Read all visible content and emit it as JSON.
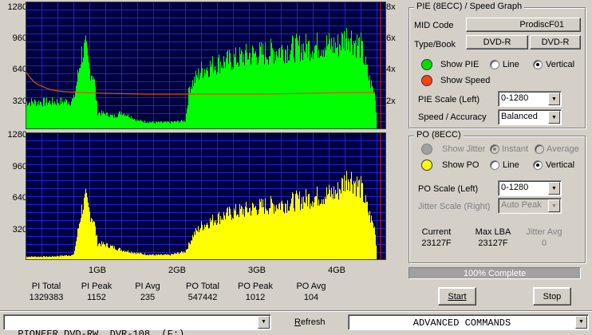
{
  "top_chart": {
    "left_axis": [
      "1280",
      "960",
      "640",
      "320"
    ],
    "right_axis": [
      "8x",
      "6x",
      "4x",
      "2x"
    ],
    "colors": {
      "background": "#000040",
      "grid": "#2a2aff",
      "pie": "#00ff00",
      "speed": "#e05000",
      "marker": "#e02000"
    }
  },
  "bottom_chart": {
    "left_axis": [
      "1280",
      "960",
      "640",
      "320"
    ],
    "colors": {
      "background": "#000040",
      "grid": "#2a2aff",
      "po": "#ffff00"
    }
  },
  "x_axis": [
    "1GB",
    "2GB",
    "3GB",
    "4GB"
  ],
  "chart_data": [
    {
      "type": "area",
      "title": "PIE (8ECC) / Speed Graph",
      "x_axis_labels": [
        "1GB",
        "2GB",
        "3GB",
        "4GB"
      ],
      "x_unit": "GB",
      "ylim_left": [
        0,
        1280
      ],
      "ylim_right": [
        0,
        8
      ],
      "series": [
        {
          "name": "PIE",
          "x": [
            0,
            0.3,
            0.55,
            0.6,
            0.7,
            0.75,
            0.8,
            0.85,
            0.9,
            1.0,
            1.1,
            1.2,
            1.3,
            1.4,
            1.5,
            1.6,
            1.7,
            1.8,
            1.9,
            2.0,
            2.05,
            2.1,
            2.2,
            2.4,
            2.6,
            2.8,
            3.0,
            3.2,
            3.4,
            3.6,
            3.8,
            3.9,
            4.0,
            4.05,
            4.1,
            4.2,
            4.3,
            4.38,
            4.4
          ],
          "values": [
            320,
            320,
            330,
            350,
            900,
            950,
            700,
            640,
            200,
            180,
            150,
            200,
            160,
            100,
            90,
            80,
            80,
            80,
            90,
            100,
            500,
            560,
            700,
            780,
            820,
            880,
            900,
            940,
            960,
            980,
            1000,
            980,
            1080,
            1120,
            1050,
            980,
            600,
            400,
            0
          ]
        },
        {
          "name": "Speed",
          "x": [
            0,
            0.05,
            0.1,
            0.15,
            0.2,
            0.3,
            0.4,
            0.5,
            0.7,
            1.0,
            1.5,
            2.0,
            2.5,
            3.0,
            3.5,
            4.0,
            4.38
          ],
          "values": [
            3.6,
            3.3,
            3.0,
            2.8,
            2.7,
            2.5,
            2.4,
            2.35,
            2.3,
            2.25,
            2.2,
            2.2,
            2.2,
            2.2,
            2.25,
            2.3,
            2.3
          ]
        }
      ]
    },
    {
      "type": "area",
      "title": "PO (8ECC)",
      "x_axis_labels": [
        "1GB",
        "2GB",
        "3GB",
        "4GB"
      ],
      "x_unit": "GB",
      "ylim": [
        0,
        1280
      ],
      "series": [
        {
          "name": "PO",
          "x": [
            0,
            0.3,
            0.6,
            0.7,
            0.75,
            0.8,
            0.85,
            0.9,
            1.0,
            1.2,
            1.4,
            1.6,
            1.8,
            2.0,
            2.1,
            2.2,
            2.4,
            2.6,
            2.8,
            3.0,
            3.2,
            3.4,
            3.6,
            3.8,
            3.9,
            4.0,
            4.05,
            4.1,
            4.2,
            4.3,
            4.38,
            4.4
          ],
          "values": [
            40,
            40,
            60,
            600,
            720,
            560,
            480,
            200,
            180,
            120,
            80,
            60,
            60,
            100,
            300,
            400,
            500,
            560,
            600,
            640,
            660,
            700,
            740,
            780,
            800,
            940,
            1000,
            940,
            850,
            550,
            350,
            0
          ]
        }
      ]
    }
  ],
  "stats": [
    {
      "label": "PI Total",
      "value": "1329383"
    },
    {
      "label": "PI Peak",
      "value": "1152"
    },
    {
      "label": "PI Avg",
      "value": "235"
    },
    {
      "label": "PO Total",
      "value": "547442"
    },
    {
      "label": "PO Peak",
      "value": "1012"
    },
    {
      "label": "PO Avg",
      "value": "104"
    }
  ],
  "pie_group": {
    "title": "PIE (8ECC) / Speed Graph",
    "mid_code_label": "MID Code",
    "mid_code_value": "ProdiscF01",
    "type_book_label": "Type/Book",
    "type_value": "DVD-R",
    "book_value": "DVD-R",
    "show_pie_label": "Show PIE",
    "show_speed_label": "Show Speed",
    "line_label": "Line",
    "vertical_label": "Vertical",
    "pie_scale_label": "PIE Scale (Left)",
    "pie_scale_value": "0-1280",
    "speed_accuracy_label": "Speed / Accuracy",
    "speed_accuracy_value": "Balanced",
    "pie_color": "#00ff00",
    "speed_color": "#ff4010"
  },
  "po_group": {
    "title": "PO (8ECC)",
    "show_jitter_label": "Show Jitter",
    "instant_label": "Instant",
    "average_label": "Average",
    "show_po_label": "Show PO",
    "line_label": "Line",
    "vertical_label": "Vertical",
    "po_scale_label": "PO Scale (Left)",
    "po_scale_value": "0-1280",
    "jitter_scale_label": "Jitter Scale (Right)",
    "jitter_scale_value": "Auto Peak",
    "current_label": "Current",
    "current_value": "23127F",
    "max_lba_label": "Max LBA",
    "max_lba_value": "23127F",
    "jitter_avg_label": "Jitter Avg",
    "jitter_avg_value": "0",
    "po_color": "#ffff00",
    "jitter_color": "#a0a0a0"
  },
  "progress": {
    "label": "100% Complete",
    "value": 1.0
  },
  "buttons": {
    "start": "Start",
    "stop": "Stop"
  },
  "bottom_bar": {
    "drive": "PIONEER DVD-RW  DVR-108  (F:)",
    "refresh": "Refresh",
    "advanced": "ADVANCED COMMANDS"
  }
}
